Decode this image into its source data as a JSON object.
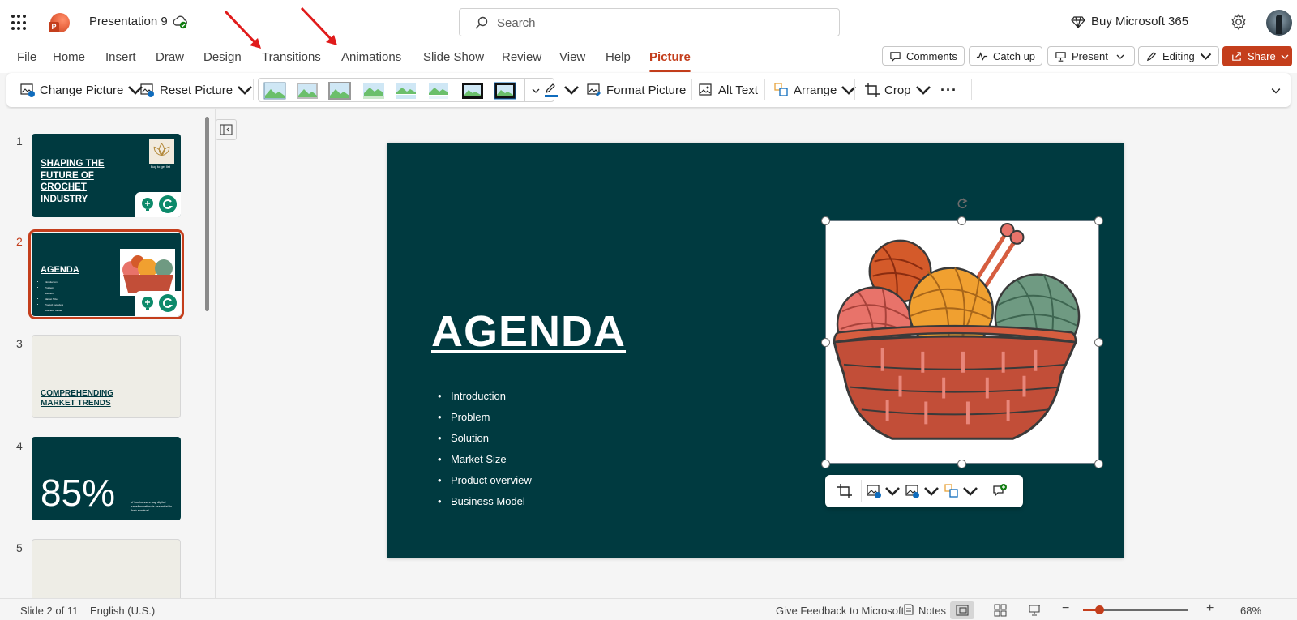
{
  "titlebar": {
    "doc_title": "Presentation 9",
    "search_placeholder": "Search",
    "buy_label": "Buy Microsoft 365"
  },
  "tabs": [
    "File",
    "Home",
    "Insert",
    "Draw",
    "Design",
    "Transitions",
    "Animations",
    "Slide Show",
    "Review",
    "View",
    "Help",
    "Picture"
  ],
  "active_tab": "Picture",
  "actions": {
    "comments": "Comments",
    "catch_up": "Catch up",
    "present": "Present",
    "editing": "Editing",
    "share": "Share"
  },
  "ribbon": {
    "change_picture": "Change Picture",
    "reset_picture": "Reset Picture",
    "format_picture": "Format Picture",
    "alt_text": "Alt Text",
    "arrange": "Arrange",
    "crop": "Crop",
    "more": "···"
  },
  "slides": [
    {
      "num": "1",
      "title": "SHAPING THE FUTURE OF CROCHET INDUSTRY",
      "logo_caption": "Buy to get list"
    },
    {
      "num": "2",
      "title": "AGENDA",
      "items": [
        "Introduction",
        "Problem",
        "Solution",
        "Market Size",
        "Product overview",
        "Business Model"
      ]
    },
    {
      "num": "3",
      "title": "COMPREHENDING MARKET TRENDS"
    },
    {
      "num": "4",
      "stat": "85%",
      "caption": "of businesses say digital transformation is essential to their survival."
    },
    {
      "num": "5"
    }
  ],
  "main_slide": {
    "title": "AGENDA",
    "items": [
      "Introduction",
      "Problem",
      "Solution",
      "Market Size",
      "Product overview",
      "Business Model"
    ]
  },
  "statusbar": {
    "slide_info": "Slide 2 of 11",
    "language": "English (U.S.)",
    "feedback": "Give Feedback to Microsoft",
    "notes": "Notes",
    "zoom_minus": "−",
    "zoom_plus": "+",
    "zoom": "68%",
    "zoom_level": 0.15
  },
  "colors": {
    "accent": "#c43e1c",
    "slide_bg": "#003a40",
    "slide3_bg": "#eeede6"
  }
}
